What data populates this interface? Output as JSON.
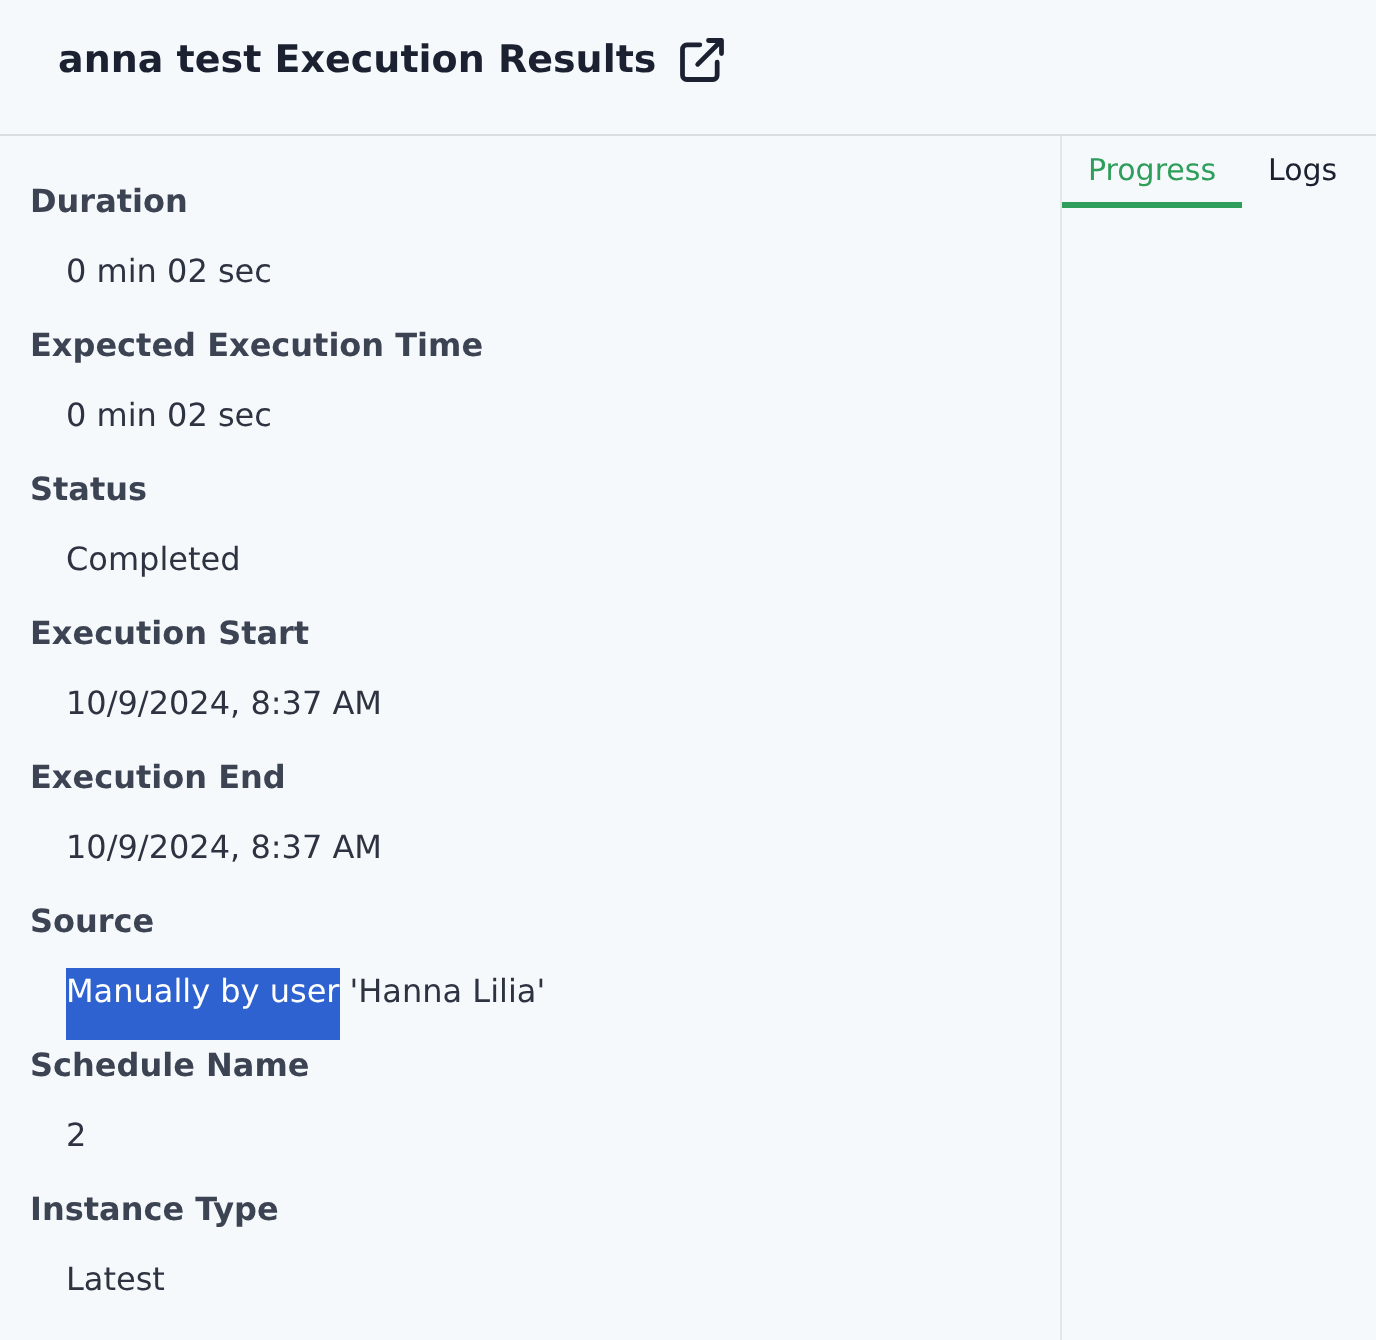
{
  "header": {
    "title": "anna test Execution Results"
  },
  "fields": [
    {
      "label": "Duration",
      "value_parts": [
        {
          "text": "0 min 02 sec",
          "highlighted": false
        }
      ]
    },
    {
      "label": "Expected Execution Time",
      "value_parts": [
        {
          "text": "0 min 02 sec",
          "highlighted": false
        }
      ]
    },
    {
      "label": "Status",
      "value_parts": [
        {
          "text": "Completed",
          "highlighted": false
        }
      ]
    },
    {
      "label": "Execution Start",
      "value_parts": [
        {
          "text": "10/9/2024, 8:37 AM",
          "highlighted": false
        }
      ]
    },
    {
      "label": "Execution End",
      "value_parts": [
        {
          "text": "10/9/2024, 8:37 AM",
          "highlighted": false
        }
      ]
    },
    {
      "label": "Source",
      "value_parts": [
        {
          "text": "Manually by user",
          "highlighted": true
        },
        {
          "text": "'Hanna Lilia'",
          "highlighted": false
        }
      ]
    },
    {
      "label": "Schedule Name",
      "value_parts": [
        {
          "text": "2",
          "highlighted": false
        }
      ]
    },
    {
      "label": "Instance Type",
      "value_parts": [
        {
          "text": "Latest",
          "highlighted": false
        }
      ]
    }
  ],
  "tabs": [
    {
      "label": "Progress",
      "selected": true
    },
    {
      "label": "Logs",
      "selected": false
    }
  ]
}
